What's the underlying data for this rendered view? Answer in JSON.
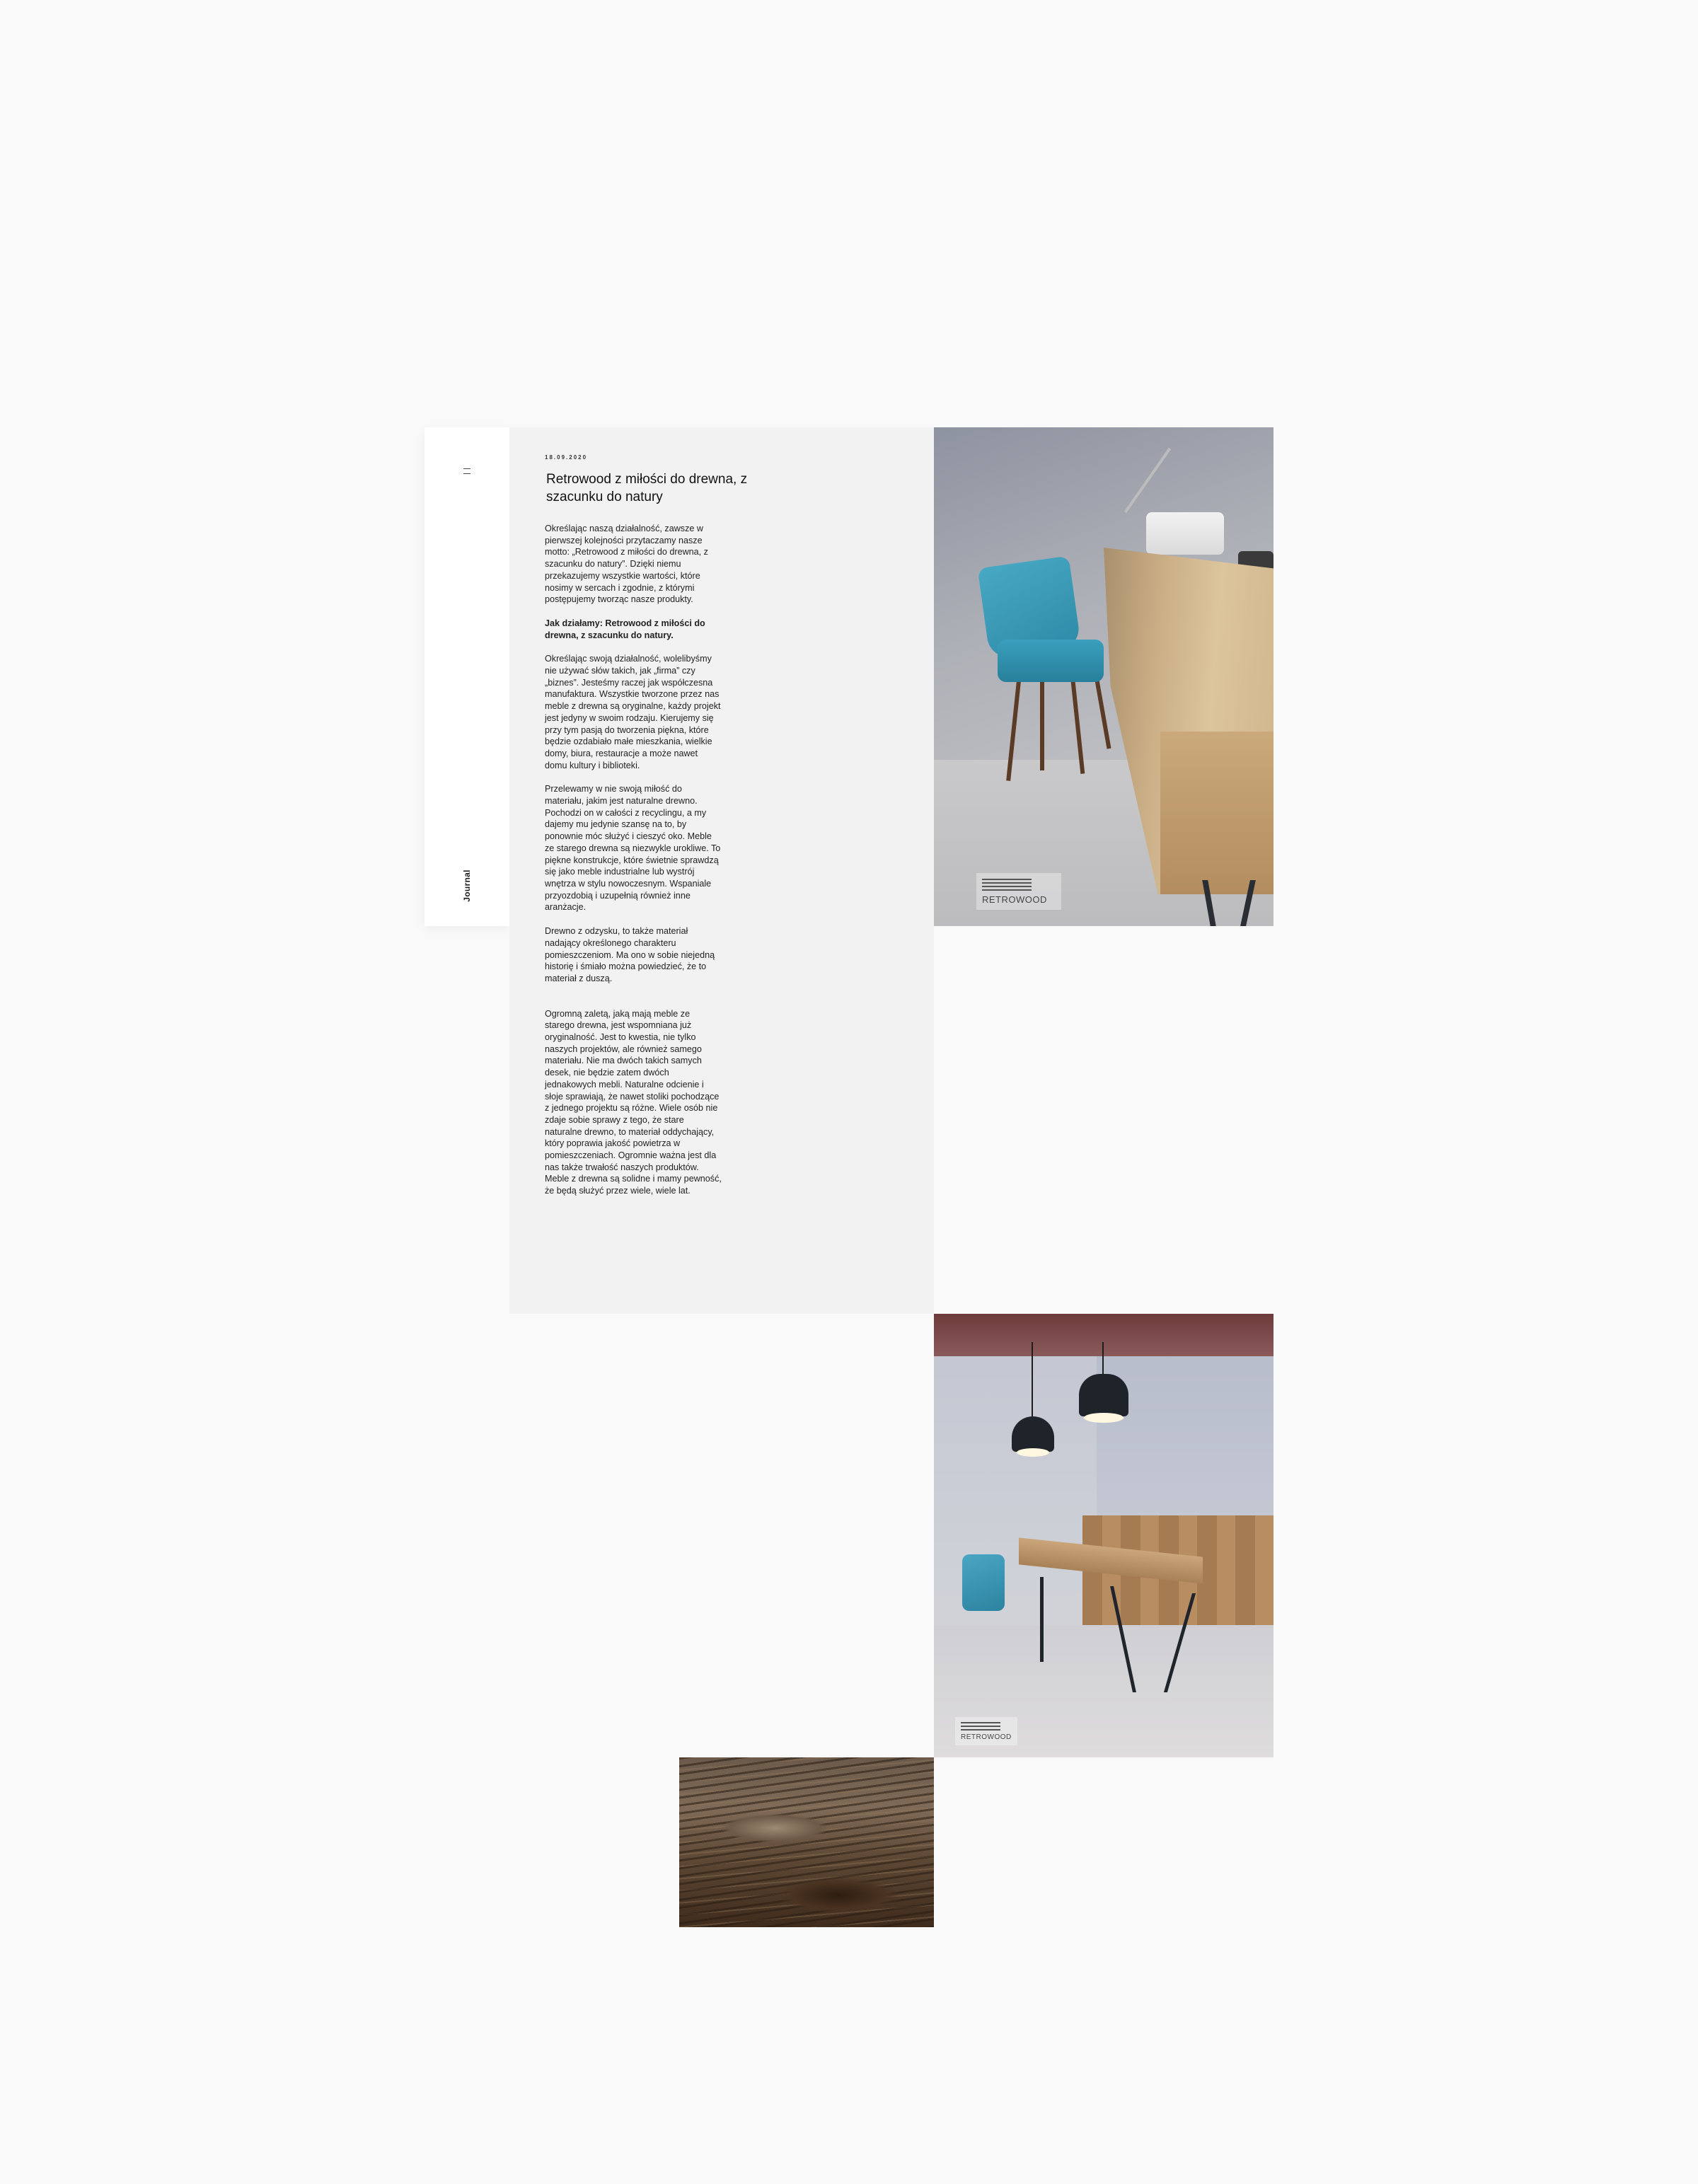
{
  "sidebar": {
    "menu_icon": "hamburger-icon",
    "section_label": "Journal"
  },
  "article": {
    "date": "18.09.2020",
    "title": "Retrowood z miłości do drewna, z szacunku do natury",
    "paragraphs": [
      "Określając naszą działalność, zawsze w pierwszej kolejności przytaczamy nasze motto: „Retrowood z miłości do drewna, z szacunku do natury”. Dzięki niemu przekazujemy wszystkie wartości, które nosimy w sercach i zgodnie, z którymi postępujemy tworząc nasze produkty.",
      "Jak działamy: Retrowood z miłości do drewna, z szacunku do natury.",
      "Określając swoją działalność, wolelibyśmy nie używać słów takich, jak „firma” czy „biznes”. Jesteśmy raczej jak współczesna manufaktura. Wszystkie tworzone przez nas meble z drewna są oryginalne, każdy projekt jest jedyny w swoim rodzaju. Kierujemy się przy tym pasją do tworzenia piękna, które będzie ozdabiało małe mieszkania, wielkie domy, biura, restauracje a może nawet domu kultury i biblioteki.",
      "Przelewamy w nie swoją miłość do materiału, jakim jest naturalne drewno. Pochodzi on w całości z recyclingu, a my dajemy mu jedynie szansę na to, by ponownie móc służyć i cieszyć oko. Meble ze starego drewna są niezwykle urokliwe. To piękne konstrukcje, które świetnie sprawdzą się jako meble industrialne lub wystrój wnętrza w stylu nowoczesnym. Wspaniale przyozdobią i uzupełnią również inne aranżacje.",
      "Drewno z odzysku, to także materiał nadający określonego charakteru pomieszczeniom. Ma ono w sobie niejedną historię i śmiało można powiedzieć, że to materiał z duszą.",
      "Ogromną zaletą, jaką mają meble ze starego drewna, jest wspomniana już oryginalność. Jest to kwestia, nie tylko naszych projektów, ale również samego materiału. Nie ma dwóch takich samych desek, nie będzie zatem dwóch jednakowych mebli. Naturalne odcienie i słoje sprawiają, że nawet stoliki pochodzące z jednego projektu są różne. Wiele osób nie zdaje sobie sprawy z tego, że stare naturalne drewno, to materiał oddychający, który poprawia jakość powietrza w pomieszczeniach. Ogromnie ważna jest dla nas także trwałość naszych produktów. Meble z drewna są solidne i mamy pewność, że będą służyć przez wiele, wiele lat."
    ]
  },
  "photos": {
    "logo_text": "RETROWOOD"
  },
  "colors": {
    "page_background": "#f9f9f9",
    "article_background": "#f2f2f2",
    "sidebar_background": "#ffffff"
  }
}
